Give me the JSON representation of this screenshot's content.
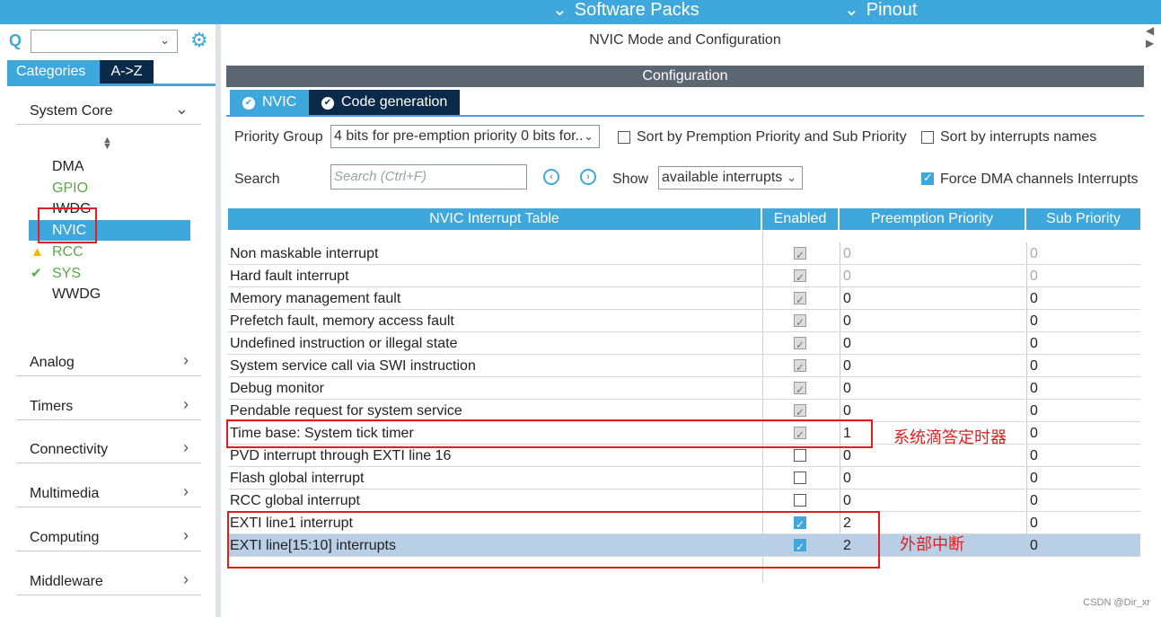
{
  "topbar": {
    "menus": [
      {
        "label": "Software Packs"
      },
      {
        "label": "Pinout"
      }
    ]
  },
  "left": {
    "search": {
      "value": ""
    },
    "tabs": [
      {
        "label": "Categories"
      },
      {
        "label": "A->Z"
      }
    ],
    "categories": [
      {
        "label": "System Core",
        "expanded": true
      },
      {
        "label": "Analog"
      },
      {
        "label": "Timers"
      },
      {
        "label": "Connectivity"
      },
      {
        "label": "Multimedia"
      },
      {
        "label": "Computing"
      },
      {
        "label": "Middleware"
      }
    ],
    "system_core_items": [
      {
        "label": "DMA",
        "status": "none"
      },
      {
        "label": "GPIO",
        "status": "green"
      },
      {
        "label": "IWDG",
        "status": "none"
      },
      {
        "label": "NVIC",
        "status": "selected"
      },
      {
        "label": "RCC",
        "status": "warning"
      },
      {
        "label": "SYS",
        "status": "ok"
      },
      {
        "label": "WWDG",
        "status": "none"
      }
    ]
  },
  "main": {
    "mode_title": "NVIC Mode and Configuration",
    "config_title": "Configuration",
    "tabs": [
      {
        "label": "NVIC"
      },
      {
        "label": "Code generation"
      }
    ],
    "priority_group_label": "Priority Group",
    "priority_group_value": "4 bits for pre-emption priority 0 bits for..",
    "sort_premption_label": "Sort by Premption Priority and Sub Priority",
    "sort_names_label": "Sort by interrupts names",
    "search_label": "Search",
    "search_placeholder": "Search (Ctrl+F)",
    "show_label": "Show",
    "show_value": "available interrupts",
    "force_dma_label": "Force DMA channels Interrupts",
    "table_headers": {
      "name": "NVIC Interrupt Table",
      "enabled": "Enabled",
      "preemption": "Preemption Priority",
      "sub": "Sub Priority"
    },
    "rows": [
      {
        "name": "Non maskable interrupt",
        "enabled": "locked",
        "pp": "0",
        "sp": "0",
        "disabled": true
      },
      {
        "name": "Hard fault interrupt",
        "enabled": "locked",
        "pp": "0",
        "sp": "0",
        "disabled": true
      },
      {
        "name": "Memory management fault",
        "enabled": "locked",
        "pp": "0",
        "sp": "0"
      },
      {
        "name": "Prefetch fault, memory access fault",
        "enabled": "locked",
        "pp": "0",
        "sp": "0"
      },
      {
        "name": "Undefined instruction or illegal state",
        "enabled": "locked",
        "pp": "0",
        "sp": "0"
      },
      {
        "name": "System service call via SWI instruction",
        "enabled": "locked",
        "pp": "0",
        "sp": "0"
      },
      {
        "name": "Debug monitor",
        "enabled": "locked",
        "pp": "0",
        "sp": "0"
      },
      {
        "name": "Pendable request for system service",
        "enabled": "locked",
        "pp": "0",
        "sp": "0"
      },
      {
        "name": "Time base: System tick timer",
        "enabled": "locked",
        "pp": "1",
        "sp": "0"
      },
      {
        "name": "PVD interrupt through EXTI line 16",
        "enabled": "off",
        "pp": "0",
        "sp": "0"
      },
      {
        "name": "Flash global interrupt",
        "enabled": "off",
        "pp": "0",
        "sp": "0"
      },
      {
        "name": "RCC global interrupt",
        "enabled": "off",
        "pp": "0",
        "sp": "0"
      },
      {
        "name": "EXTI line1 interrupt",
        "enabled": "on",
        "pp": "2",
        "sp": "0"
      },
      {
        "name": "EXTI line[15:10] interrupts",
        "enabled": "on",
        "pp": "2",
        "sp": "0",
        "selected": true
      }
    ]
  },
  "annotations": {
    "systick_note": "系统滴答定时器",
    "exti_note": "外部中断"
  },
  "watermark": "CSDN @Dir_xr",
  "colors": {
    "accent": "#3ea8dc",
    "dark_tab": "#0b2a4a",
    "config_header": "#5c6670",
    "annotation_red": "#e02020",
    "selected_row": "#b8cfe6"
  }
}
